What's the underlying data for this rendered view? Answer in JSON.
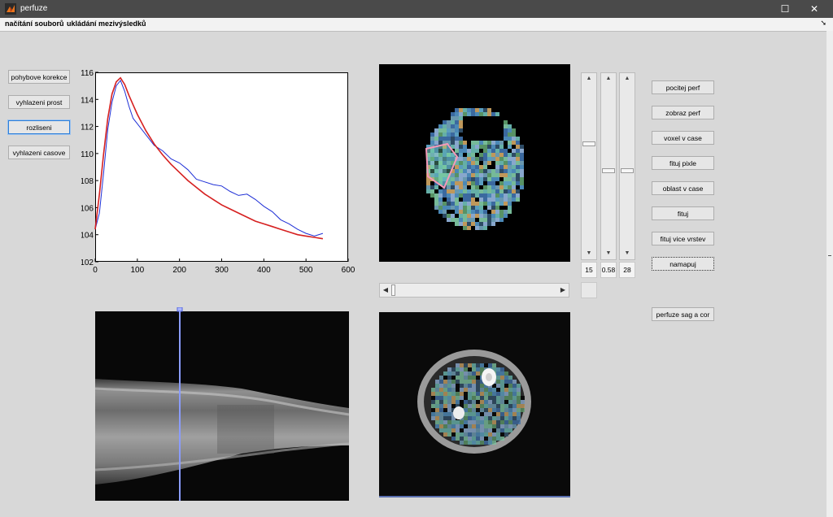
{
  "window": {
    "title": "perfuze",
    "maximize_glyph": "☐",
    "close_glyph": "✕",
    "app_icon": "matlab-figure-icon"
  },
  "menu": {
    "items": [
      "načítání souborů",
      "ukládání mezivýsledků"
    ],
    "overflow_glyph": "➘"
  },
  "left_buttons": [
    "pohybove korekce",
    "vyhlazeni prost",
    "rozliseni",
    "vyhlazeni casove"
  ],
  "right_buttons": [
    "pocitej perf",
    "zobraz perf",
    "voxel v case",
    "fituj pixle",
    "oblast v case",
    "fituj",
    "fituj vice vrstev",
    "namapuj",
    "perfuze sag a cor"
  ],
  "slider_values": [
    "15",
    "0.58",
    "28"
  ],
  "slider_levels": [
    0.64,
    0.47,
    0.47
  ],
  "colors": {
    "titlebar": "#4a4a4a",
    "fit_curve": "#d62020",
    "data_curve": "#1e2fd6",
    "roi": "#f59ab8",
    "cursor_line": "#8a9cff"
  },
  "chart_data": {
    "type": "line",
    "xlim": [
      0,
      600
    ],
    "ylim": [
      102,
      116
    ],
    "xticks": [
      "0",
      "100",
      "200",
      "300",
      "400",
      "500",
      "600"
    ],
    "yticks": [
      "102",
      "104",
      "106",
      "108",
      "110",
      "112",
      "114",
      "116"
    ],
    "series": [
      {
        "color": "#1e2fd6",
        "x": [
          0,
          10,
          20,
          30,
          40,
          50,
          60,
          70,
          80,
          90,
          100,
          120,
          140,
          160,
          180,
          200,
          220,
          240,
          260,
          280,
          300,
          320,
          340,
          360,
          380,
          400,
          420,
          440,
          460,
          480,
          500,
          520,
          540
        ],
        "y": [
          104.4,
          105.6,
          108.6,
          111.8,
          113.8,
          115.0,
          115.4,
          114.6,
          113.5,
          112.6,
          112.2,
          111.4,
          110.6,
          110.2,
          109.6,
          109.3,
          108.8,
          108.1,
          107.9,
          107.7,
          107.6,
          107.2,
          106.9,
          107.0,
          106.6,
          106.1,
          105.7,
          105.1,
          104.8,
          104.4,
          104.1,
          103.9,
          104.1
        ]
      },
      {
        "color": "#d62020",
        "x": [
          0,
          10,
          20,
          30,
          40,
          50,
          60,
          70,
          80,
          90,
          100,
          120,
          140,
          160,
          180,
          200,
          220,
          240,
          260,
          280,
          300,
          320,
          340,
          360,
          380,
          400,
          420,
          440,
          460,
          480,
          500,
          520,
          540
        ],
        "y": [
          104.4,
          107.0,
          110.0,
          112.6,
          114.4,
          115.3,
          115.6,
          115.1,
          114.3,
          113.6,
          112.9,
          111.7,
          110.7,
          109.9,
          109.2,
          108.6,
          108.0,
          107.5,
          107.0,
          106.6,
          106.2,
          105.9,
          105.6,
          105.3,
          105.0,
          104.8,
          104.6,
          104.4,
          104.2,
          104.0,
          103.9,
          103.8,
          103.7
        ]
      }
    ]
  }
}
